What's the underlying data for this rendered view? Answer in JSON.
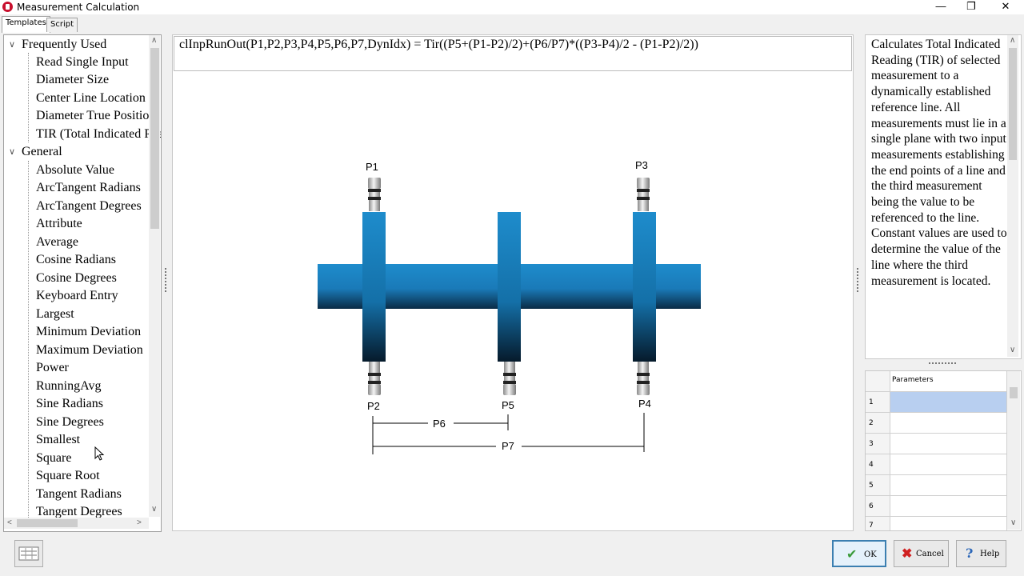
{
  "window": {
    "title": "Measurement Calculation",
    "minimize": "—",
    "restore": "❐",
    "close": "✕"
  },
  "tabs": [
    "Templates",
    "Script"
  ],
  "tree": {
    "groups": [
      {
        "label": "Frequently Used",
        "items": [
          "Read Single Input",
          "Diameter Size",
          "Center Line Location",
          "Diameter True Position",
          "TIR (Total Indicated Reading)"
        ]
      },
      {
        "label": "General",
        "items": [
          "Absolute Value",
          "ArcTangent Radians",
          "ArcTangent Degrees",
          "Attribute",
          "Average",
          "Cosine Radians",
          "Cosine Degrees",
          "Keyboard Entry",
          "Largest",
          "Minimum Deviation",
          "Maximum Deviation",
          "Power",
          "RunningAvg",
          "Sine Radians",
          "Sine Degrees",
          "Smallest",
          "Square",
          "Square Root",
          "Tangent Radians",
          "Tangent Degrees"
        ]
      }
    ]
  },
  "formula": "clInpRunOut(P1,P2,P3,P4,P5,P6,P7,DynIdx) = Tir((P5+(P1-P2)/2)+(P6/P7)*((P3-P4)/2 - (P1-P2)/2))",
  "diagram": {
    "labels": {
      "p1": "P1",
      "p2": "P2",
      "p3": "P3",
      "p4": "P4",
      "p5": "P5",
      "p6": "P6",
      "p7": "P7"
    },
    "colors": {
      "shaft": "#1e8ccc",
      "shaft_dark": "#0a2b45"
    }
  },
  "description": "Calculates Total Indicated Reading (TIR) of selected measurement to a dynamically established reference line. All measurements must lie in a single plane with two input measurements establishing the end points of a line and the third measurement being the value to be referenced to the line. Constant values are used to determine the value of the line where the third measurement is located.",
  "parameters": {
    "header": "Parameters",
    "rows": [
      "1",
      "2",
      "3",
      "4",
      "5",
      "6",
      "7"
    ],
    "selected_color": "#b8cff0"
  },
  "buttons": {
    "ok": "OK",
    "cancel": "Cancel",
    "help": "Help"
  },
  "icons": {
    "app": "app-logo-icon",
    "calc": "calculator-icon",
    "ok": "checkmark-icon",
    "cancel": "x-icon",
    "help": "question-mark-icon"
  }
}
